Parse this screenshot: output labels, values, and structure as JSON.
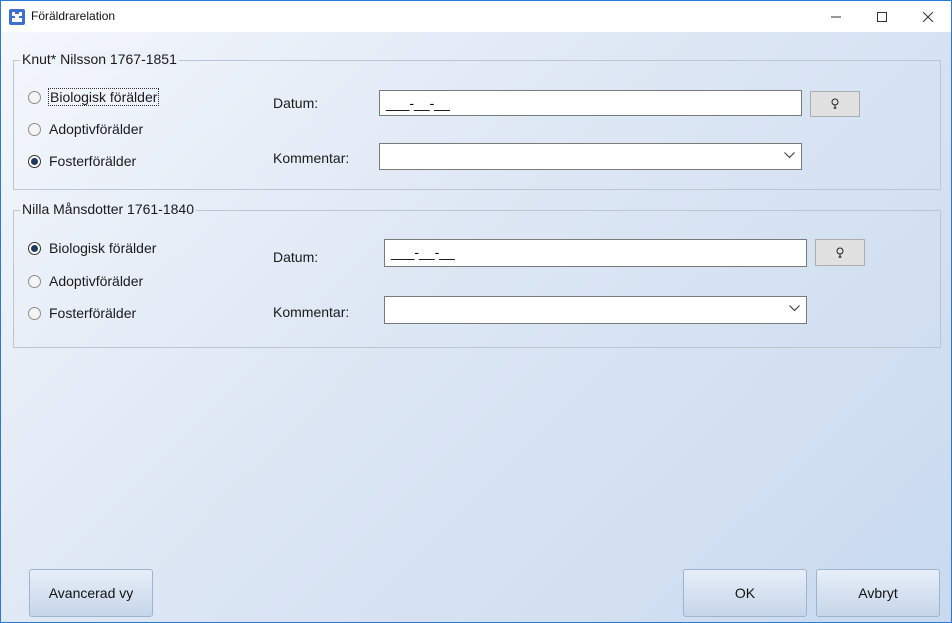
{
  "window": {
    "title": "Föräldrarelation",
    "icon": "app-icon",
    "controls": {
      "minimize": "minimize-icon",
      "maximize": "maximize-icon",
      "close": "close-icon"
    }
  },
  "groups": [
    {
      "legend": "Knut* Nilsson 1767-1851",
      "options": [
        "Biologisk förälder",
        "Adoptivförälder",
        "Fosterförälder"
      ],
      "selected": "Fosterförälder",
      "focused": "Biologisk förälder",
      "datum_label": "Datum:",
      "datum_value": "___-__-__",
      "kommentar_label": "Kommentar:",
      "kommentar_value": ""
    },
    {
      "legend": "Nilla Månsdotter 1761-1840",
      "options": [
        "Biologisk förälder",
        "Adoptivförälder",
        "Fosterförälder"
      ],
      "selected": "Biologisk förälder",
      "datum_label": "Datum:",
      "datum_value": "___-__-__",
      "kommentar_label": "Kommentar:",
      "kommentar_value": ""
    }
  ],
  "buttons": {
    "advanced": "Avancerad vy",
    "ok": "OK",
    "cancel": "Avbryt"
  },
  "colors": {
    "title_border": "#2b79d7",
    "background_start": "#f4f7fc",
    "background_end": "#c9daef"
  }
}
